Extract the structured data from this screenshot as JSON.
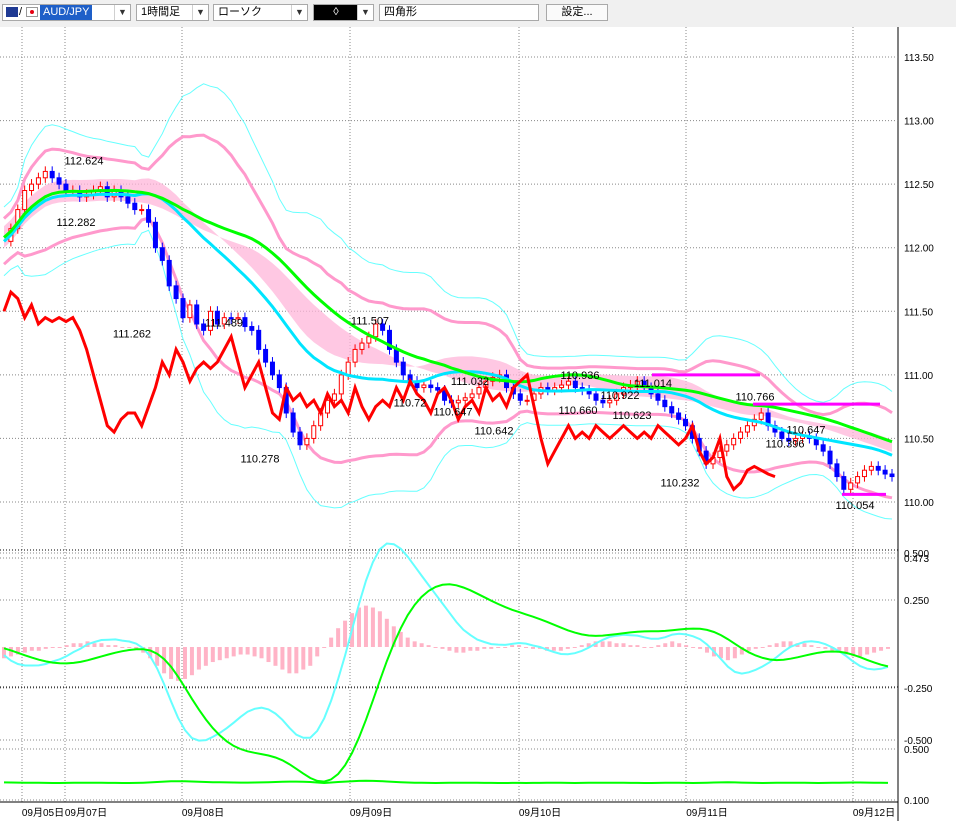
{
  "toolbar": {
    "symbol": "AUD/JPY",
    "symbol_sep": "/",
    "timeframe": "1時間足",
    "chart_style": "ローソク",
    "drawing_mode": "◊",
    "drawing_tool": "四角形",
    "settings_label": "設定..."
  },
  "colors": {
    "up_candle": "#ff0000",
    "down_candle": "#0000ff",
    "cloud": "#ffb6d9",
    "line_red": "#ff0000",
    "line_green": "#00ff00",
    "line_cyan": "#00e5ff",
    "band_pink": "#ff99cc",
    "band_cyan": "#66ffff",
    "marker_magenta": "#ff00ff"
  },
  "chart_data": [
    {
      "type": "candlestick",
      "price_axis_ticks": [
        "113.50",
        "113.00",
        "112.50",
        "112.00",
        "111.50",
        "111.00",
        "110.50",
        "110.00"
      ],
      "ylim": [
        109.8,
        113.75
      ],
      "date_labels": [
        "09月05日",
        "09月07日",
        "09月08日",
        "09月09日",
        "09月10日",
        "09月11日",
        "09月12日"
      ],
      "annotations": [
        {
          "label": "112.624",
          "value": 112.624
        },
        {
          "label": "112.282",
          "value": 112.282
        },
        {
          "label": "111.262",
          "value": 111.262
        },
        {
          "label": "111.489",
          "value": 111.489
        },
        {
          "label": "110.278",
          "value": 110.278
        },
        {
          "label": "111.507",
          "value": 111.507
        },
        {
          "label": "110.72",
          "value": 110.72
        },
        {
          "label": "111.032",
          "value": 111.032
        },
        {
          "label": "110.647",
          "value": 110.647
        },
        {
          "label": "110.642",
          "value": 110.642
        },
        {
          "label": "110.936",
          "value": 110.936
        },
        {
          "label": "110.922",
          "value": 110.922
        },
        {
          "label": "110.660",
          "value": 110.66
        },
        {
          "label": "111.014",
          "value": 111.014
        },
        {
          "label": "110.623",
          "value": 110.623
        },
        {
          "label": "110.232",
          "value": 110.232
        },
        {
          "label": "110.766",
          "value": 110.766
        },
        {
          "label": "110.647",
          "value": 110.647
        },
        {
          "label": "110.396",
          "value": 110.396
        },
        {
          "label": "110.054",
          "value": 110.054
        }
      ],
      "close_series": [
        112.05,
        112.15,
        112.3,
        112.45,
        112.5,
        112.55,
        112.6,
        112.55,
        112.5,
        112.45,
        112.45,
        112.4,
        112.42,
        112.45,
        112.48,
        112.4,
        112.45,
        112.4,
        112.35,
        112.3,
        112.3,
        112.2,
        112.0,
        111.9,
        111.7,
        111.6,
        111.45,
        111.55,
        111.4,
        111.35,
        111.5,
        111.4,
        111.45,
        111.44,
        111.45,
        111.38,
        111.35,
        111.2,
        111.1,
        111.0,
        110.9,
        110.7,
        110.55,
        110.45,
        110.5,
        110.6,
        110.7,
        110.8,
        110.85,
        111.0,
        111.1,
        111.2,
        111.25,
        111.3,
        111.4,
        111.35,
        111.2,
        111.1,
        111.0,
        110.95,
        110.9,
        110.92,
        110.9,
        110.88,
        110.8,
        110.78,
        110.8,
        110.82,
        110.85,
        110.9,
        110.95,
        110.98,
        111.0,
        110.9,
        110.85,
        110.8,
        110.8,
        110.85,
        110.9,
        110.88,
        110.9,
        110.92,
        110.95,
        110.9,
        110.88,
        110.85,
        110.8,
        110.78,
        110.8,
        110.85,
        110.9,
        110.92,
        110.95,
        110.9,
        110.85,
        110.8,
        110.75,
        110.7,
        110.65,
        110.6,
        110.5,
        110.4,
        110.3,
        110.35,
        110.4,
        110.45,
        110.5,
        110.55,
        110.6,
        110.65,
        110.7,
        110.6,
        110.55,
        110.5,
        110.48,
        110.5,
        110.52,
        110.5,
        110.45,
        110.4,
        110.3,
        110.2,
        110.1,
        110.15,
        110.2,
        110.25,
        110.28,
        110.25,
        110.22,
        110.2
      ],
      "red_line": [
        111.5,
        111.65,
        111.6,
        111.45,
        111.55,
        111.4,
        111.45,
        111.42,
        111.45,
        111.42,
        111.45,
        111.35,
        111.2,
        111.0,
        110.8,
        110.6,
        110.55,
        110.65,
        110.7,
        110.7,
        110.6,
        110.75,
        110.9,
        111.1,
        111.0,
        111.2,
        111.1,
        110.95,
        111.05,
        111.1,
        111.05,
        111.1,
        111.2,
        111.3,
        111.1,
        110.9,
        111.0,
        111.1,
        110.9,
        110.7,
        110.65,
        110.9,
        110.8,
        110.85,
        110.75,
        110.8,
        110.7,
        110.85,
        110.75,
        110.8,
        110.7,
        110.9,
        110.75,
        110.65,
        110.75,
        110.8,
        110.75,
        110.9,
        110.8,
        110.95,
        110.85,
        110.8,
        110.7,
        110.85,
        110.9,
        110.8,
        110.65,
        110.75,
        110.8,
        110.7,
        110.9,
        110.8,
        110.85,
        110.75,
        110.9,
        110.95,
        111.0,
        110.75,
        110.5,
        110.3,
        110.4,
        110.5,
        110.6,
        110.5,
        110.55,
        110.5,
        110.6,
        110.55,
        110.5,
        110.55,
        110.6,
        110.55,
        110.5,
        110.55,
        110.5,
        110.6,
        110.55,
        110.5,
        110.45,
        110.5,
        110.6,
        110.4,
        110.3,
        110.35,
        110.5,
        110.2,
        110.1,
        110.15,
        110.25,
        110.28,
        110.25,
        110.22,
        110.2
      ]
    },
    {
      "type": "bar",
      "name": "macd",
      "ticks": [
        "0.500",
        "0.473",
        "0.250",
        "-0.250",
        "-0.500"
      ],
      "ylim": [
        -0.55,
        0.55
      ],
      "histogram": [
        -0.06,
        -0.05,
        -0.04,
        -0.03,
        -0.02,
        -0.02,
        -0.01,
        0.0,
        0.0,
        0.01,
        0.02,
        0.02,
        0.03,
        0.02,
        0.02,
        0.01,
        0.01,
        0.0,
        0.0,
        -0.01,
        -0.03,
        -0.06,
        -0.1,
        -0.14,
        -0.17,
        -0.18,
        -0.17,
        -0.15,
        -0.12,
        -0.1,
        -0.08,
        -0.07,
        -0.06,
        -0.05,
        -0.04,
        -0.04,
        -0.05,
        -0.06,
        -0.08,
        -0.1,
        -0.12,
        -0.14,
        -0.14,
        -0.12,
        -0.1,
        -0.05,
        0.0,
        0.05,
        0.1,
        0.14,
        0.18,
        0.21,
        0.22,
        0.21,
        0.19,
        0.15,
        0.11,
        0.08,
        0.05,
        0.03,
        0.02,
        0.01,
        0.0,
        -0.01,
        -0.02,
        -0.03,
        -0.03,
        -0.02,
        -0.02,
        -0.01,
        -0.01,
        0.0,
        0.0,
        0.01,
        0.01,
        0.0,
        -0.01,
        -0.01,
        -0.02,
        -0.02,
        -0.02,
        -0.01,
        0.0,
        0.01,
        0.02,
        0.03,
        0.03,
        0.03,
        0.02,
        0.02,
        0.01,
        0.01,
        0.0,
        0.0,
        0.01,
        0.02,
        0.03,
        0.02,
        0.01,
        0.0,
        -0.01,
        -0.03,
        -0.05,
        -0.06,
        -0.07,
        -0.06,
        -0.04,
        -0.02,
        -0.01,
        0.0,
        0.01,
        0.02,
        0.03,
        0.03,
        0.02,
        0.02,
        0.01,
        0.0,
        -0.01,
        -0.02,
        -0.03,
        -0.04,
        -0.05,
        -0.05,
        -0.04,
        -0.03,
        -0.02,
        -0.01
      ]
    },
    {
      "type": "line",
      "name": "bottom_indicator",
      "ticks": [
        "0.500",
        "0.100"
      ]
    }
  ]
}
